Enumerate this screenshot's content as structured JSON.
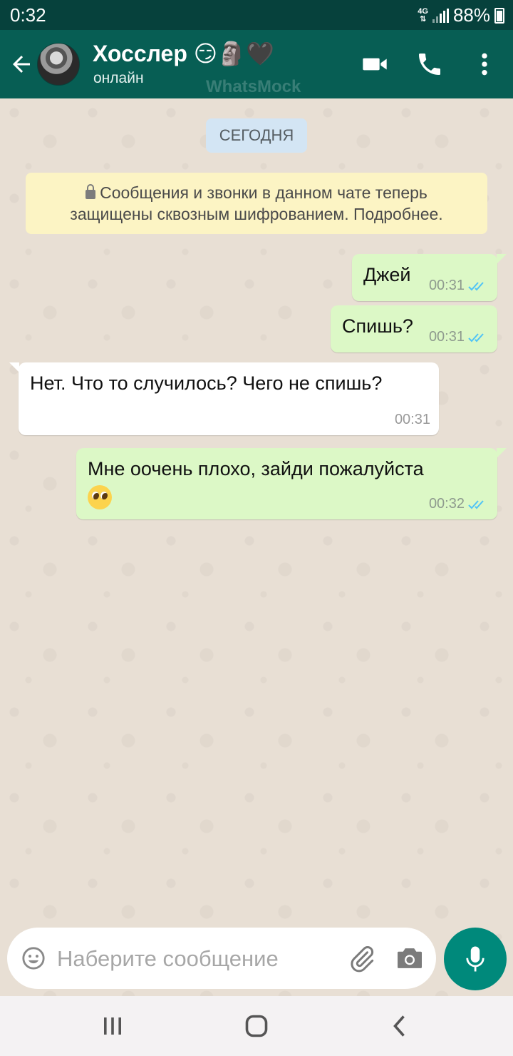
{
  "status_bar": {
    "time": "0:32",
    "network": "4G",
    "battery": "88%"
  },
  "header": {
    "contact_name": "Хосслер 😏🗿🖤",
    "contact_status": "онлайн",
    "watermark": "WhatsMock"
  },
  "chat": {
    "date_chip": "СЕГОДНЯ",
    "encryption_notice_line1": "Сообщения и звонки в данном чате теперь",
    "encryption_notice_line2": "защищены сквозным шифрованием. Подробнее.",
    "messages": [
      {
        "direction": "outgoing",
        "text": "Джей",
        "time": "00:31",
        "status": "read"
      },
      {
        "direction": "outgoing",
        "text": "Спишь?",
        "time": "00:31",
        "status": "read"
      },
      {
        "direction": "incoming",
        "text": "Нет. Что то случилось? Чего не спишь?",
        "time": "00:31"
      },
      {
        "direction": "outgoing",
        "text": "Мне оочень  плохо, зайди пожалуйста",
        "emoji": "pleading-face",
        "time": "00:32",
        "status": "read"
      }
    ]
  },
  "input": {
    "placeholder": "Наберите сообщение"
  },
  "colors": {
    "header": "#075e54",
    "status_bar": "#06413c",
    "outgoing_bubble": "#dcf8c6",
    "incoming_bubble": "#ffffff",
    "read_ticks": "#4fc3f7",
    "mic_button": "#00897b"
  }
}
